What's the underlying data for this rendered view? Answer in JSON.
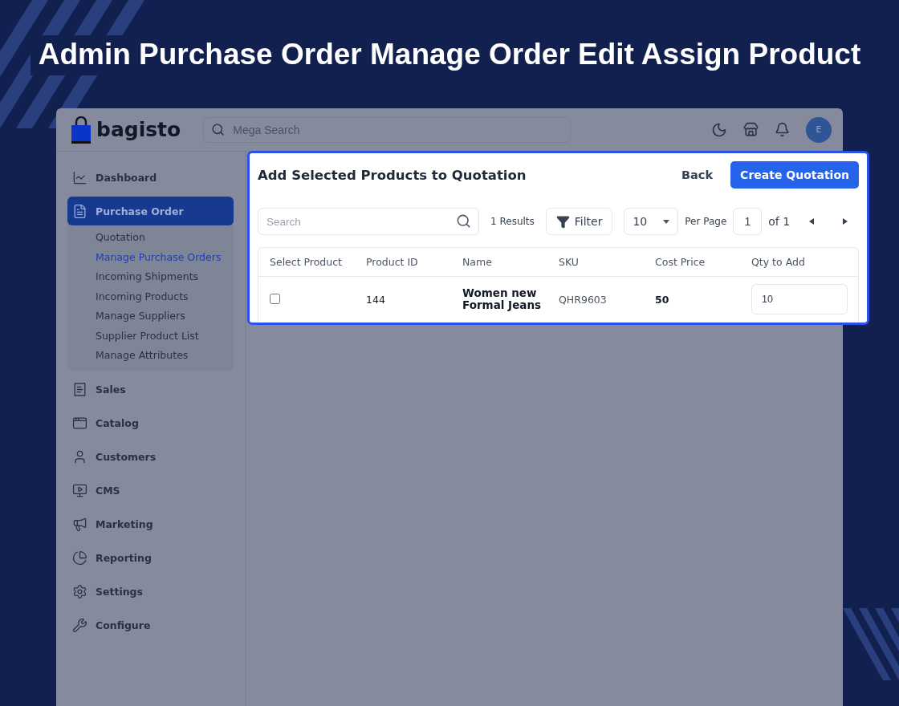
{
  "headline": "Admin Purchase Order Manage Order Edit Assign Product",
  "header": {
    "logo": "bagisto",
    "search": {
      "placeholder": "Mega Search"
    },
    "avatar": "E"
  },
  "sidebar": {
    "items": [
      {
        "label": "Dashboard",
        "selected": false
      },
      {
        "label": "Purchase Order",
        "selected": true,
        "children": [
          {
            "label": "Quotation",
            "selected": false
          },
          {
            "label": "Manage Purchase Orders",
            "selected": true
          },
          {
            "label": "Incoming Shipments",
            "selected": false
          },
          {
            "label": "Incoming Products",
            "selected": false
          },
          {
            "label": "Manage Suppliers",
            "selected": false
          },
          {
            "label": "Supplier Product List",
            "selected": false
          },
          {
            "label": "Manage Attributes",
            "selected": false
          }
        ]
      },
      {
        "label": "Sales",
        "selected": false
      },
      {
        "label": "Catalog",
        "selected": false
      },
      {
        "label": "Customers",
        "selected": false
      },
      {
        "label": "CMS",
        "selected": false
      },
      {
        "label": "Marketing",
        "selected": false
      },
      {
        "label": "Reporting",
        "selected": false
      },
      {
        "label": "Settings",
        "selected": false
      },
      {
        "label": "Configure",
        "selected": false
      }
    ]
  },
  "modal": {
    "title": "Add Selected Products to Quotation",
    "back": "Back",
    "primary": "Create Quotation",
    "search": {
      "placeholder": "Search"
    },
    "results": "1 Results",
    "filter": "Filter",
    "per_page_value": "10",
    "per_page": "Per Page",
    "page": "1",
    "page_total": "of 1",
    "table": {
      "columns": [
        "Select Product",
        "Product ID",
        "Name",
        "SKU",
        "Cost Price",
        "Qty to Add"
      ],
      "rows": [
        {
          "checked": false,
          "id": "144",
          "name": "Women new Formal Jeans",
          "sku": "QHR9603",
          "cost": "50",
          "qty": "10"
        }
      ]
    }
  }
}
